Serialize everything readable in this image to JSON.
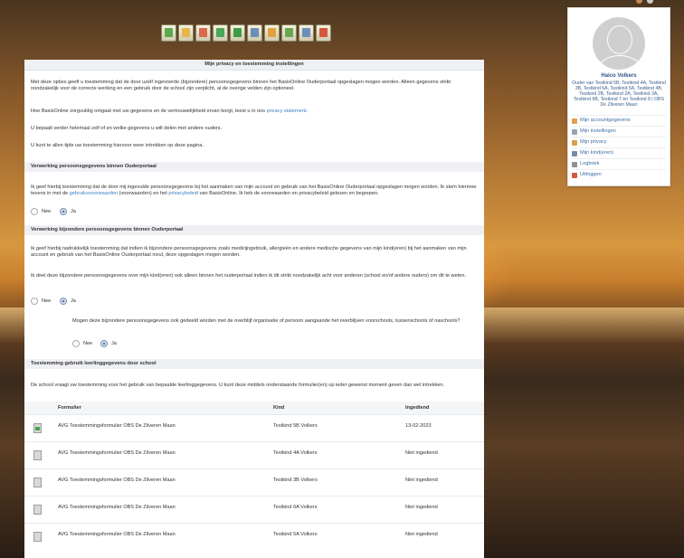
{
  "toolbar": {
    "icons": [
      {
        "name": "toolbar-icon-1",
        "color": "#5da84f"
      },
      {
        "name": "toolbar-icon-2",
        "color": "#e9b44c"
      },
      {
        "name": "toolbar-icon-3",
        "color": "#d96a4a"
      },
      {
        "name": "toolbar-icon-4",
        "color": "#4ba55a"
      },
      {
        "name": "toolbar-icon-5",
        "color": "#3e9d44"
      },
      {
        "name": "toolbar-icon-6",
        "color": "#6c8fba"
      },
      {
        "name": "toolbar-icon-7",
        "color": "#e0a13d"
      },
      {
        "name": "toolbar-icon-8",
        "color": "#6aa84f"
      },
      {
        "name": "toolbar-icon-9",
        "color": "#6c8fba"
      },
      {
        "name": "toolbar-icon-10",
        "color": "#d6553f"
      }
    ]
  },
  "privacy": {
    "title": "Mijn privacy en toestemming instellingen",
    "intro1": "Met deze opties geeft u toestemming dat de door uzelf ingevoerde (bijzondere) persoonsgegevens binnen het BasisOnline Ouderportaal opgeslagen mogen worden. Alleen gegevens strikt noodzakelijk voor de correcte werking en een gebruik door de school zijn verplicht, al de overige velden zijn optioneel.",
    "intro2_pre": "Hoe BasisOnline zorgvuldig omgaat met uw gegevens en de vertrouwelijkheid ervan borgt, leest u in ons ",
    "intro2_link": "privacy statement",
    "intro2_post": ".",
    "intro3": "U bepaalt verder helemaal zelf of en welke gegevens u wilt delen met andere ouders.",
    "intro4": "U kunt te allen tijde uw toestemming hiervoor weer intrekken op deze pagina.",
    "section1": {
      "title": "Verwerking persoonsgegevens binnen Ouderportaal",
      "text_pre": "Ik geef hierbij toestemming dat de door mij ingevulde persoonsgegevens bij het aanmaken van mijn account en gebruik van het BasisOnline Ouderportaal opgeslagen mogen worden. Ik stem hiermee tevens in met de ",
      "link1": "gebruiksvoorwaarden",
      "text_mid": " (voorwaarden) en het ",
      "link2": "privacybeleid",
      "text_post": " van BasisOnline. Ik heb de voorwaarden en privacybeleid gelezen en begrepen.",
      "no": "Nee",
      "yes": "Ja"
    },
    "section2": {
      "title": "Verwerking bijzondere persoonsgegevens binnen Ouderportaal",
      "text1": "Ik geef hierbij nadrukkelijk toestemming dat indien ik bijzondere persoonsgegevens zoals medicijngebruik, allergieën en andere medische gegevens van mijn kind(eren) bij het aanmaken van mijn account en gebruik van het BasisOnline Ouderportaal invul, deze opgeslagen mogen worden.",
      "text2": "Ik deel deze bijzondere persoonsgegevens over mijn kind(eren) ook alleen binnen het ouderportaal indien ik dit strikt noodzakelijk acht voor anderen (school en/of andere ouders) om dit te weten.",
      "no": "Nee",
      "yes": "Ja",
      "sub_question": "Mogen deze bijzondere persoonsgegevens ook gedeeld worden met de overblijf organisatie of persoon aangaande het overblijven voorschools, tussenschools of naschools?",
      "sub_no": "Nee",
      "sub_yes": "Ja"
    },
    "section3": {
      "title": "Toestemming gebruik leerlinggegevens door school",
      "text": "De school vraagt uw toestemming voor het gebruik van bepaalde leerlinggegevens. U kunt deze middels onderstaande formulier(en) op ieder gewenst moment geven dan wel intrekken."
    },
    "table": {
      "headers": [
        "Formulier",
        "Kind",
        "Ingediend"
      ],
      "rows": [
        {
          "form": "AVG Toestemmingsformulier OBS De Zilveren Maan",
          "kind": "Testkind 5B Volkers",
          "status": "13-02-2023",
          "icon": "checked-document-icon"
        },
        {
          "form": "AVG Toestemmingsformulier OBS De Zilveren Maan",
          "kind": "Testkind 4A Volkers",
          "status": "Niet ingediend",
          "icon": "document-icon"
        },
        {
          "form": "AVG Toestemmingsformulier OBS De Zilveren Maan",
          "kind": "Testkind 3B Volkers",
          "status": "Niet ingediend",
          "icon": "document-icon"
        },
        {
          "form": "AVG Toestemmingsformulier OBS De Zilveren Maan",
          "kind": "Testkind 6A Volkers",
          "status": "Niet ingediend",
          "icon": "document-icon"
        },
        {
          "form": "AVG Toestemmingsformulier OBS De Zilveren Maan",
          "kind": "Testkind 5A Volkers",
          "status": "Niet ingediend",
          "icon": "document-icon"
        }
      ]
    }
  },
  "profile": {
    "name": "Haico Volkers",
    "description": "Ouder van Testkind 5B, Testkind 4A, Testkind 3B, Testkind 6A, Testkind 5A, Testkind 4B, Testkind 2B, Testkind 2A, Testkind 3A, Testkind 6B, Testkind 7 en Testkind 8 | OBS De Zilveren Maan",
    "menu": [
      {
        "label": "Mijn accountgegevens",
        "color": "#e3a04a"
      },
      {
        "label": "Mijn instellingen",
        "color": "#9aa3ad"
      },
      {
        "label": "Mijn privacy",
        "color": "#d9a04a"
      },
      {
        "label": "Mijn kind(eren)",
        "color": "#7a8aa6"
      },
      {
        "label": "Logboek",
        "color": "#8f8f8f"
      },
      {
        "label": "Uitloggen",
        "color": "#d05a3c"
      }
    ]
  }
}
